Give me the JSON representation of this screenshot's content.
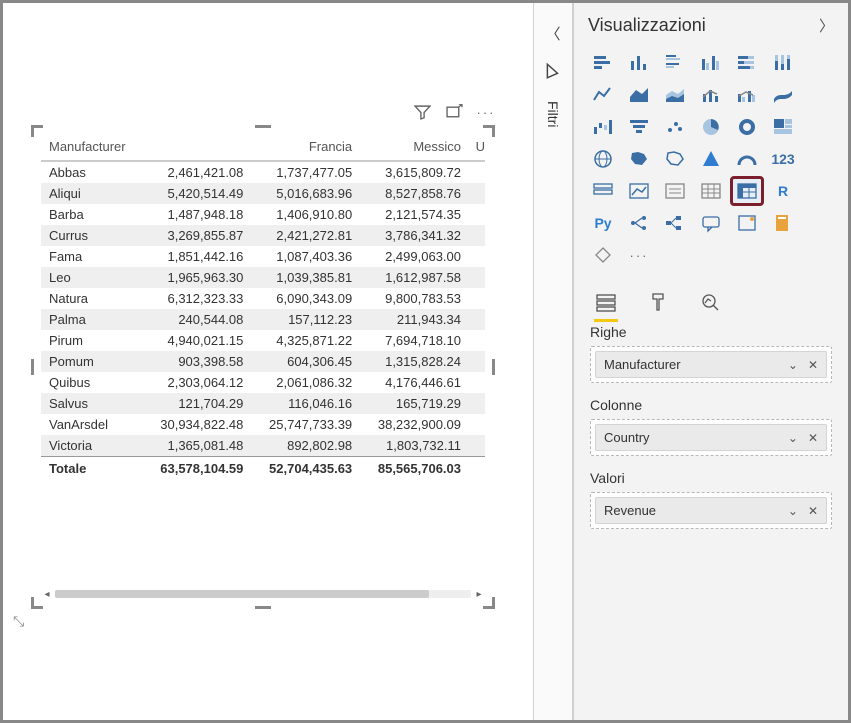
{
  "viz_pane": {
    "title": "Visualizzazioni",
    "filters_label": "Filtri"
  },
  "table": {
    "header_col": "Manufacturer",
    "columns": [
      "",
      "Francia",
      "Messico",
      "U"
    ],
    "rows": [
      {
        "label": "Abbas",
        "v": [
          "2,461,421.08",
          "1,737,477.05",
          "3,615,809.72"
        ]
      },
      {
        "label": "Aliqui",
        "v": [
          "5,420,514.49",
          "5,016,683.96",
          "8,527,858.76"
        ]
      },
      {
        "label": "Barba",
        "v": [
          "1,487,948.18",
          "1,406,910.80",
          "2,121,574.35"
        ]
      },
      {
        "label": "Currus",
        "v": [
          "3,269,855.87",
          "2,421,272.81",
          "3,786,341.32"
        ]
      },
      {
        "label": "Fama",
        "v": [
          "1,851,442.16",
          "1,087,403.36",
          "2,499,063.00"
        ]
      },
      {
        "label": "Leo",
        "v": [
          "1,965,963.30",
          "1,039,385.81",
          "1,612,987.58"
        ]
      },
      {
        "label": "Natura",
        "v": [
          "6,312,323.33",
          "6,090,343.09",
          "9,800,783.53"
        ]
      },
      {
        "label": "Palma",
        "v": [
          "240,544.08",
          "157,112.23",
          "211,943.34"
        ]
      },
      {
        "label": "Pirum",
        "v": [
          "4,940,021.15",
          "4,325,871.22",
          "7,694,718.10"
        ]
      },
      {
        "label": "Pomum",
        "v": [
          "903,398.58",
          "604,306.45",
          "1,315,828.24"
        ]
      },
      {
        "label": "Quibus",
        "v": [
          "2,303,064.12",
          "2,061,086.32",
          "4,176,446.61"
        ]
      },
      {
        "label": "Salvus",
        "v": [
          "121,704.29",
          "116,046.16",
          "165,719.29"
        ]
      },
      {
        "label": "VanArsdel",
        "v": [
          "30,934,822.48",
          "25,747,733.39",
          "38,232,900.09"
        ]
      },
      {
        "label": "Victoria",
        "v": [
          "1,365,081.48",
          "892,802.98",
          "1,803,732.11"
        ]
      }
    ],
    "total_label": "Totale",
    "totals": [
      "63,578,104.59",
      "52,704,435.63",
      "85,565,706.03"
    ]
  },
  "wells": {
    "rows_label": "Righe",
    "columns_label": "Colonne",
    "values_label": "Valori",
    "rows_field": "Manufacturer",
    "columns_field": "Country",
    "values_field": "Revenue"
  }
}
